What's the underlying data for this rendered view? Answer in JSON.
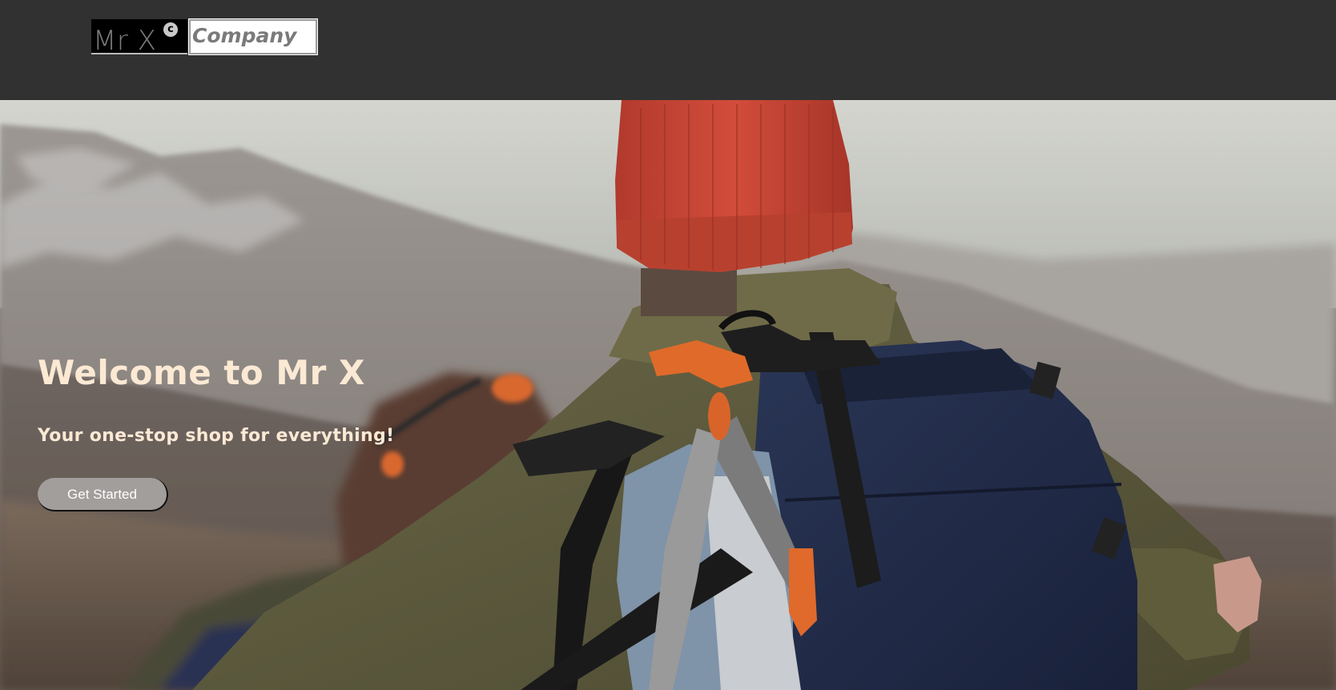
{
  "header": {
    "logo": {
      "mark_text": "Mr X",
      "copyright_symbol": "c",
      "company_text": "Company"
    }
  },
  "hero": {
    "title": "Welcome to Mr X",
    "subtitle": "Your one-stop shop for everything!",
    "cta_label": "Get Started",
    "image_description_icon": "hiker-photo"
  },
  "colors": {
    "header_bg": "#313131",
    "hero_text": "#fbe9d4",
    "button_bg": "#a19e9c",
    "beanie": "#c9483a",
    "jacket": "#5c5a3c",
    "backpack": "#1f2a44"
  }
}
